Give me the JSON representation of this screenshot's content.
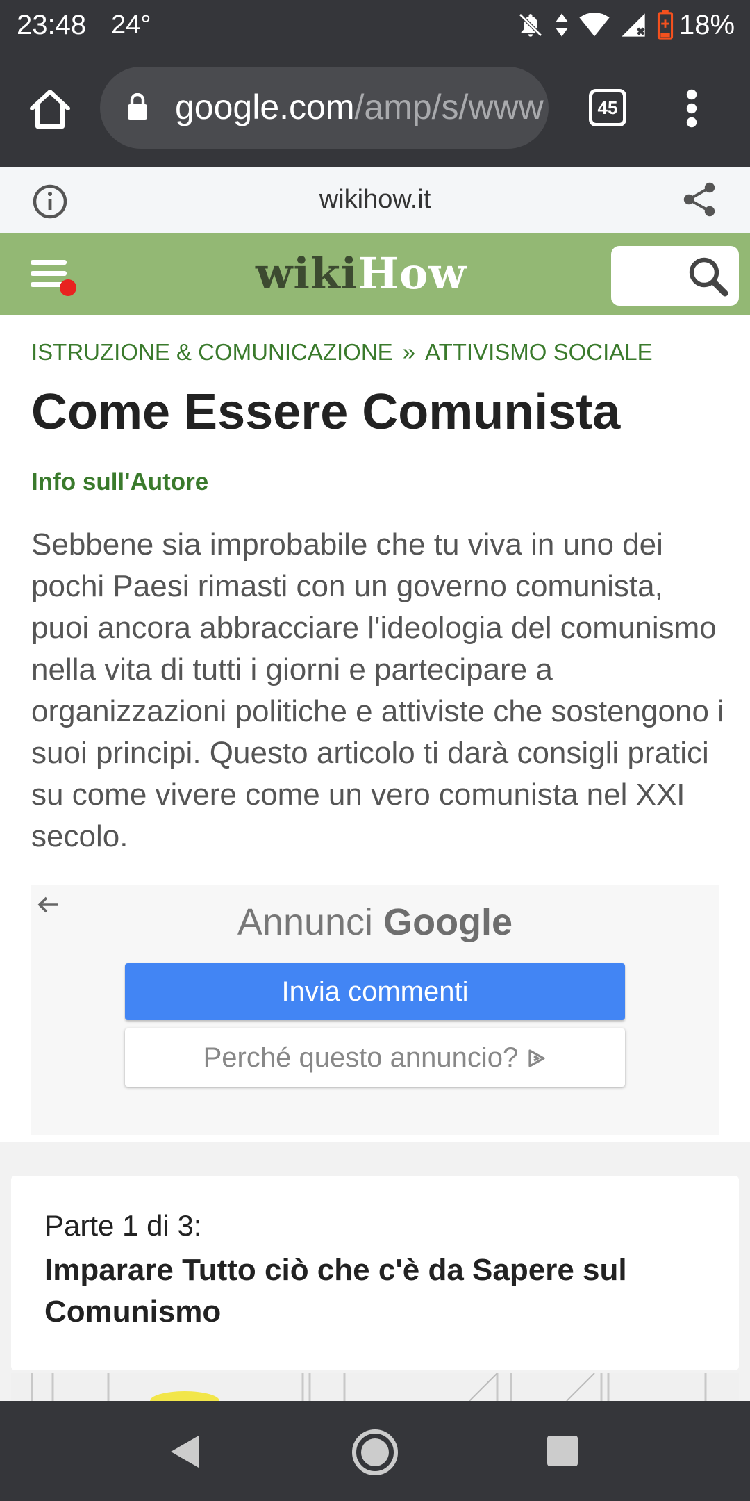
{
  "status_bar": {
    "time": "23:48",
    "temperature": "24°",
    "battery": "18%",
    "icons": [
      "notifications-off-icon",
      "data-arrows-icon",
      "wifi-icon",
      "cell-signal-icon",
      "battery-icon"
    ]
  },
  "browser": {
    "url_host": "google.com",
    "url_path": "/amp/s/www",
    "tab_count": "45",
    "amp_host": "wikihow.it"
  },
  "site": {
    "logo_part1": "wiki",
    "logo_part2": "How",
    "header_color": "#93b874"
  },
  "article": {
    "breadcrumb": [
      "ISTRUZIONE & COMUNICAZIONE",
      "ATTIVISMO SOCIALE"
    ],
    "breadcrumb_separator": "»",
    "title": "Come Essere Comunista",
    "author_link": "Info sull'Autore",
    "intro": "Sebbene sia improbabile che tu viva in uno dei pochi Paesi rimasti con un governo comunista, puoi ancora abbracciare l'ideologia del comunismo nella vita di tutti i giorni e partecipare a organizzazioni politiche e attiviste che sostengono i suoi principi. Questo articolo ti darà consigli pratici su come vivere come un vero comunista nel XXI secolo."
  },
  "ad": {
    "label": "Annunci",
    "brand": "Google",
    "send_feedback": "Invia commenti",
    "why_this_ad": "Perché questo annuncio?",
    "accent": "#4285f4"
  },
  "section": {
    "part": "Parte 1 di 3:",
    "title": "Imparare Tutto ciò che c'è da Sapere sul Comunismo"
  }
}
